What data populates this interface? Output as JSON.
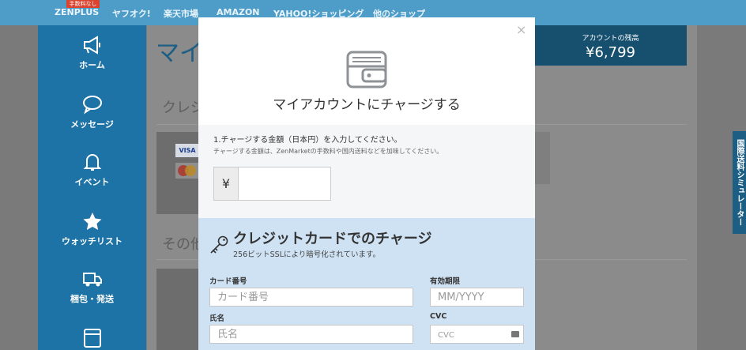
{
  "topnav": {
    "badge": "手数料なし",
    "items": [
      "ZENPLUS",
      "ヤフオク!",
      "楽天市場",
      "AMAZON",
      "YAHOO!ショッピング",
      "他のショップ"
    ]
  },
  "sidebar": {
    "items": [
      {
        "label": "ホーム",
        "icon": "megaphone-icon"
      },
      {
        "label": "メッセージ",
        "icon": "chat-bubble-icon"
      },
      {
        "label": "イベント",
        "icon": "bell-icon"
      },
      {
        "label": "ウォッチリスト",
        "icon": "star-icon"
      },
      {
        "label": "梱包・発送",
        "icon": "truck-icon"
      },
      {
        "label": "",
        "icon": "wallet-icon"
      }
    ]
  },
  "page": {
    "title_fragment": "マイ",
    "section_credit_fragment": "クレジ",
    "section_other_fragment": "その他",
    "card_visa": "VISA"
  },
  "balance": {
    "label": "アカウントの残高",
    "value": "¥6,799"
  },
  "simulator_tab": "国際送料シミュレーター",
  "modal": {
    "title": "マイアカウントにチャージする",
    "amount": {
      "label": "1.チャージする金額（日本円）を入力してください。",
      "note": "チャージする金額は、ZenMarketの手数料や国内送料などを加味してください。",
      "currency": "¥",
      "value": ""
    },
    "credit_card": {
      "title": "クレジットカードでのチャージ",
      "subtitle": "256ビットSSLにより暗号化されています。",
      "card_number_label": "カード番号",
      "card_number_placeholder": "カード番号",
      "expiry_label": "有効期限",
      "expiry_placeholder": "MM/YYYY",
      "name_label": "氏名",
      "name_placeholder": "氏名",
      "cvc_label": "CVC",
      "cvc_placeholder": "CVC"
    }
  },
  "colors": {
    "nav": "#4e9dc9",
    "sidebar": "#1d72a6",
    "cc_section": "#cfe2f3",
    "balance_box": "#17506f"
  }
}
